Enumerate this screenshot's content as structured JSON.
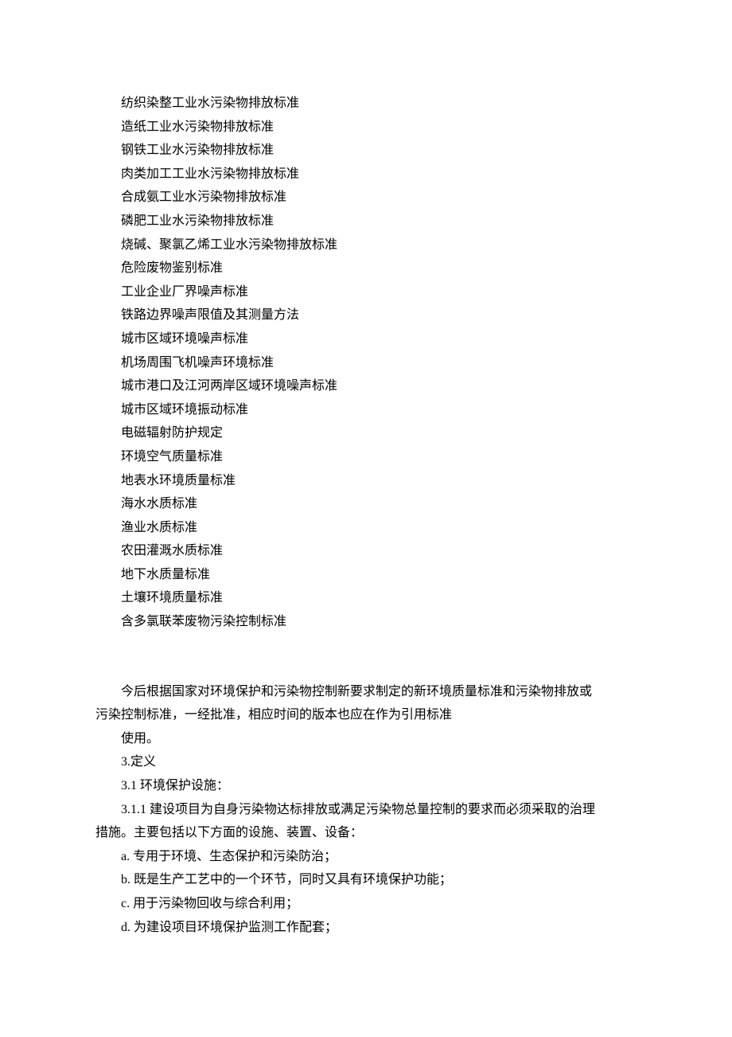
{
  "standards": [
    "纺织染整工业水污染物排放标准",
    "造纸工业水污染物排放标准",
    "钢铁工业水污染物排放标准",
    "肉类加工工业水污染物排放标准",
    "合成氨工业水污染物排放标准",
    "磷肥工业水污染物排放标准",
    "烧碱、聚氯乙烯工业水污染物排放标准",
    "危险废物鉴别标准",
    "工业企业厂界噪声标准",
    "铁路边界噪声限值及其测量方法",
    "城市区域环境噪声标准",
    "机场周围飞机噪声环境标准",
    "城市港口及江河两岸区域环境噪声标准",
    "城市区域环境振动标准",
    "电磁辐射防护规定",
    "环境空气质量标准",
    "地表水环境质量标准",
    "海水水质标准",
    "渔业水质标准",
    "农田灌溉水质标准",
    "地下水质量标准",
    "土壤环境质量标准",
    "含多氯联苯废物污染控制标准"
  ],
  "body": {
    "para1_line1": "今后根据国家对环境保护和污染物控制新要求制定的新环境质量标准和污染物排放或",
    "para1_line2": "污染控制标准，一经批准，相应时间的版本也应在作为引用标准",
    "para1_line3": "使用。",
    "section3": "3.定义",
    "section3_1": "3.1 环境保护设施：",
    "section3_1_1_line1": "3.1.1 建设项目为自身污染物达标排放或满足污染物总量控制的要求而必须采取的治理",
    "section3_1_1_line2": "措施。主要包括以下方面的设施、装置、设备：",
    "item_a": "a. 专用于环境、生态保护和污染防治；",
    "item_b": "b. 既是生产工艺中的一个环节，同时又具有环境保护功能；",
    "item_c": "c. 用于污染物回收与综合利用；",
    "item_d": "d. 为建设项目环境保护监测工作配套；"
  }
}
